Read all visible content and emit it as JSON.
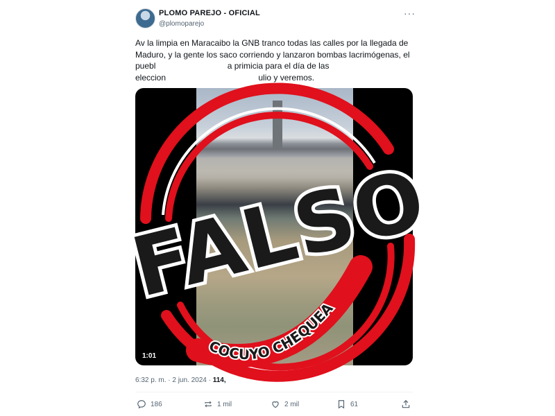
{
  "account": {
    "name": "PLOMO PAREJO - OFICIAL",
    "handle": "@plomoparejo",
    "more_icon": "more-horizontal-icon"
  },
  "tweet": {
    "text": "Av la limpia en Maracaibo la GNB tranco  todas las calles por la llegada de Maduro, y la gente los saco corriendo y lanzaron bombas lacrimógenas, el puebl                               a primicia para el día de las eleccion                                        ulio y veremos.",
    "video_duration": "1:01",
    "time": "6:32 p. m. · 2 jun. 2024 · ",
    "views": "114,"
  },
  "stamp": {
    "word": "FALSO",
    "brand": "COCUYO CHEQUEA",
    "color": "#e0101c",
    "ink": "#1a1a1a"
  },
  "actions": {
    "replies": {
      "icon": "reply-icon",
      "count": "186"
    },
    "reposts": {
      "icon": "repost-icon",
      "count": "1 mil"
    },
    "likes": {
      "icon": "heart-icon",
      "count": "2 mil"
    },
    "bookmarks": {
      "icon": "bookmark-icon",
      "count": "61"
    },
    "share": {
      "icon": "share-icon"
    }
  }
}
